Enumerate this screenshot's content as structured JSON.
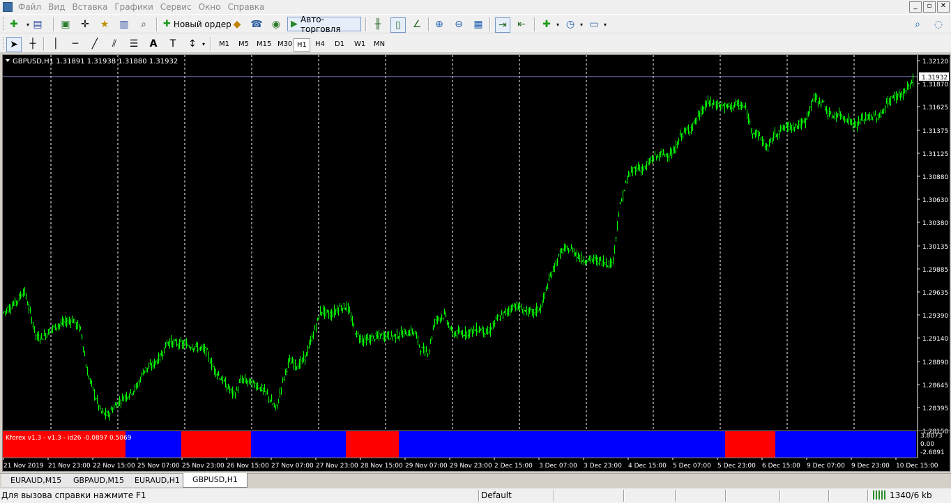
{
  "menu": [
    "Файл",
    "Вид",
    "Вставка",
    "Графики",
    "Сервис",
    "Окно",
    "Справка"
  ],
  "window_buttons": [
    "_",
    "▫",
    "✕"
  ],
  "toolbar1": {
    "new_order_label": "Новый ордер",
    "autotrading_label": "Авто-торговля"
  },
  "toolbar2": {
    "timeframes": [
      "M1",
      "M5",
      "M15",
      "M30",
      "H1",
      "H4",
      "D1",
      "W1",
      "MN"
    ],
    "active_timeframe": "H1",
    "text_tool": "A"
  },
  "chart": {
    "info": "GBPUSD,H1  1.31891 1.31938 1.31880 1.31932",
    "price_labels": [
      "1.32120",
      "1.31870",
      "1.31625",
      "1.31375",
      "1.31125",
      "1.30880",
      "1.30630",
      "1.30380",
      "1.30135",
      "1.29885",
      "1.29635",
      "1.29390",
      "1.29140",
      "1.28890",
      "1.28645",
      "1.28395",
      "1.28150"
    ],
    "current_price": "1.31932",
    "time_labels": [
      "21 Nov 2019",
      "21 Nov 23:00",
      "22 Nov 15:00",
      "25 Nov 07:00",
      "25 Nov 23:00",
      "26 Nov 15:00",
      "27 Nov 07:00",
      "27 Nov 23:00",
      "28 Nov 15:00",
      "29 Nov 07:00",
      "29 Nov 23:00",
      "2 Dec 15:00",
      "3 Dec 07:00",
      "3 Dec 23:00",
      "4 Dec 15:00",
      "5 Dec 07:00",
      "5 Dec 23:00",
      "6 Dec 15:00",
      "9 Dec 07:00",
      "9 Dec 23:00",
      "10 Dec 15:00"
    ],
    "indicator_label": "Kforex v1.3 - v1.3 - id26 -0.0897 0.5069",
    "indicator_scale": [
      "3.8073",
      "0.00",
      "-2.6891"
    ],
    "indicator_segments": [
      "red",
      "blue",
      "red",
      "blue",
      "red",
      "blue",
      "red",
      "blue"
    ],
    "colors": {
      "bull": "#00ff00",
      "background": "#000000",
      "red": "#ff0000",
      "blue": "#0000ff",
      "grid": "#ffffff"
    }
  },
  "tabs": [
    "EURAUD,M15",
    "GBPAUD,M15",
    "EURAUD,H1",
    "GBPUSD,H1"
  ],
  "active_tab": "GBPUSD,H1",
  "status": {
    "help": "Для вызова справки нажмите F1",
    "profile": "Default",
    "traffic": "1340/6 kb"
  }
}
